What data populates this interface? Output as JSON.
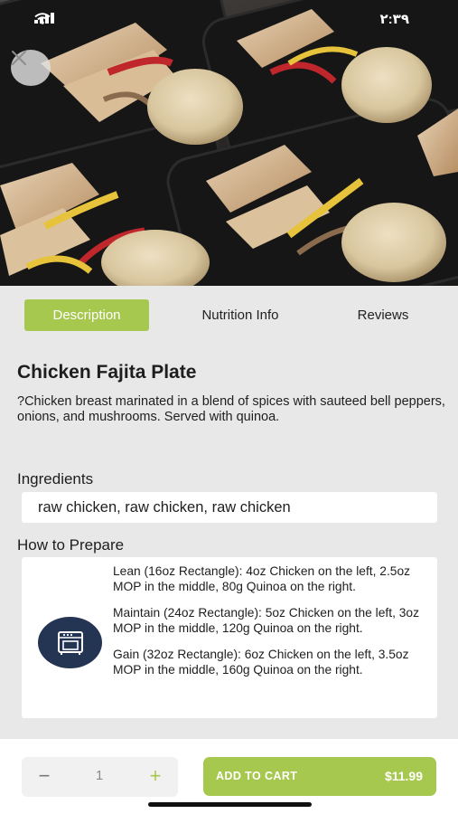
{
  "status_bar": {
    "time": "٢:٣٩",
    "icons": [
      "signal-icon",
      "wifi-icon"
    ]
  },
  "hero": {
    "image_description_icon": "meal-prep-photo",
    "close_icon": "close-icon"
  },
  "tabs": [
    {
      "label": "Description",
      "active": true
    },
    {
      "label": "Nutrition Info",
      "active": false
    },
    {
      "label": "Reviews",
      "active": false
    }
  ],
  "product": {
    "title": "Chicken Fajita Plate",
    "description": "?Chicken breast marinated in a blend of spices with sauteed bell peppers, onions, and mushrooms. Served with quinoa."
  },
  "ingredients": {
    "heading": "Ingredients",
    "value": "raw chicken, raw chicken, raw chicken"
  },
  "prepare": {
    "heading": "How to Prepare",
    "icon": "oven-icon",
    "items": [
      "Lean (16oz Rectangle): 4oz Chicken on the left, 2.5oz MOP in the middle, 80g Quinoa on the right.",
      "Maintain (24oz Rectangle): 5oz Chicken on the left, 3oz MOP in the middle, 120g Quinoa on the right.",
      "Gain (32oz Rectangle): 6oz Chicken on the left, 3.5oz MOP in the middle, 160g Quinoa on the right."
    ]
  },
  "cart": {
    "minus": "−",
    "quantity": "1",
    "plus": "+",
    "add_label": "ADD TO CART",
    "price": "$11.99"
  },
  "colors": {
    "accent": "#a7c84e",
    "icon_bg": "#243453",
    "page_bg": "#e8e8e8"
  }
}
